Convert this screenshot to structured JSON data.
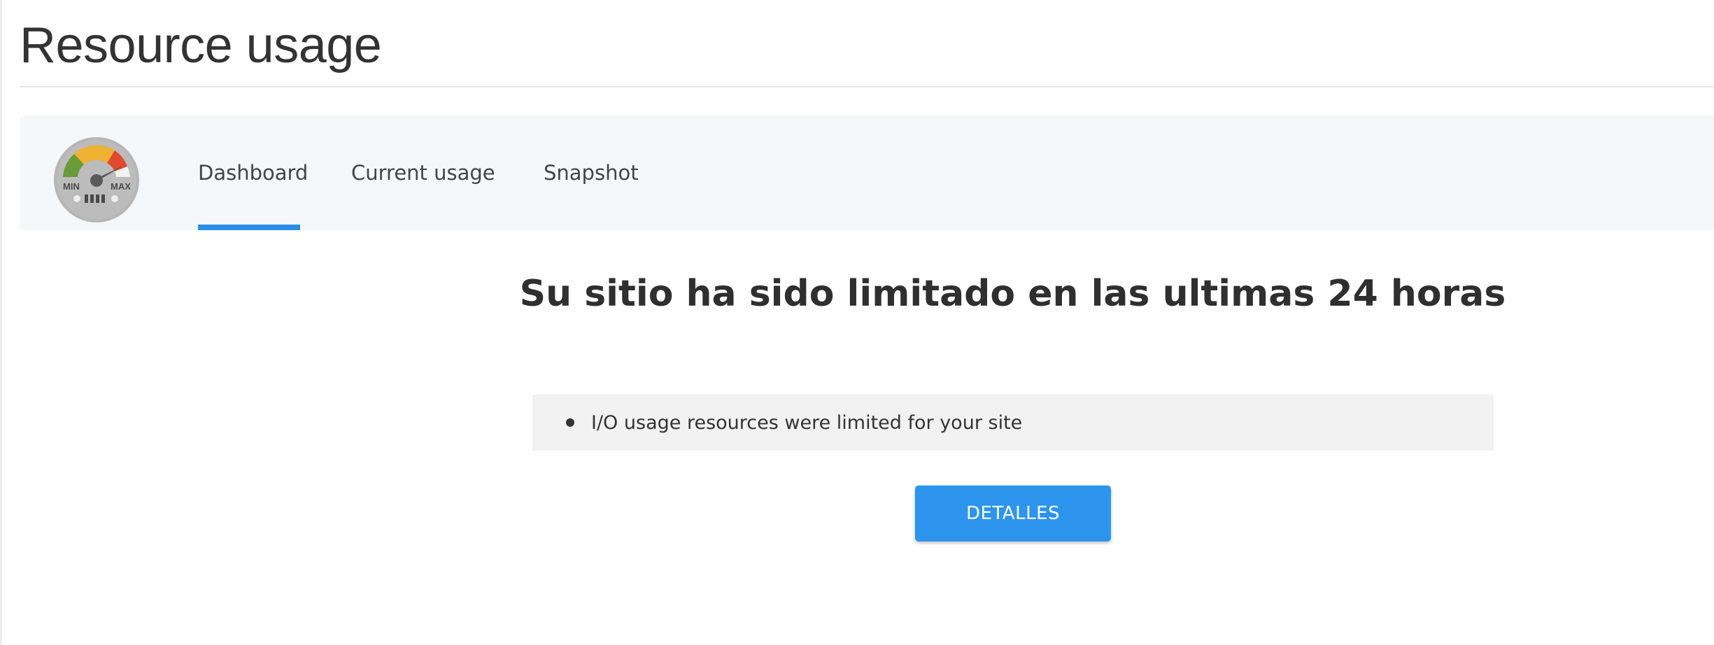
{
  "page": {
    "title": "Resource usage"
  },
  "nav": {
    "logo_icon": "speedometer-gauge-icon",
    "logo_labels": {
      "min": "MIN",
      "max": "MAX"
    },
    "tabs": [
      {
        "label": "Dashboard",
        "active": true
      },
      {
        "label": "Current usage",
        "active": false
      },
      {
        "label": "Snapshot",
        "active": false
      }
    ]
  },
  "main": {
    "heading": "Su sitio ha sido limitado en las ultimas 24 horas",
    "notices": [
      "I/O usage resources were limited for your site"
    ],
    "details_button_label": "DETALLES"
  },
  "colors": {
    "accent": "#2b8ee7",
    "button": "#2d95ee",
    "nav_background": "#f6f7f9",
    "notice_background": "#f2f2f2"
  }
}
